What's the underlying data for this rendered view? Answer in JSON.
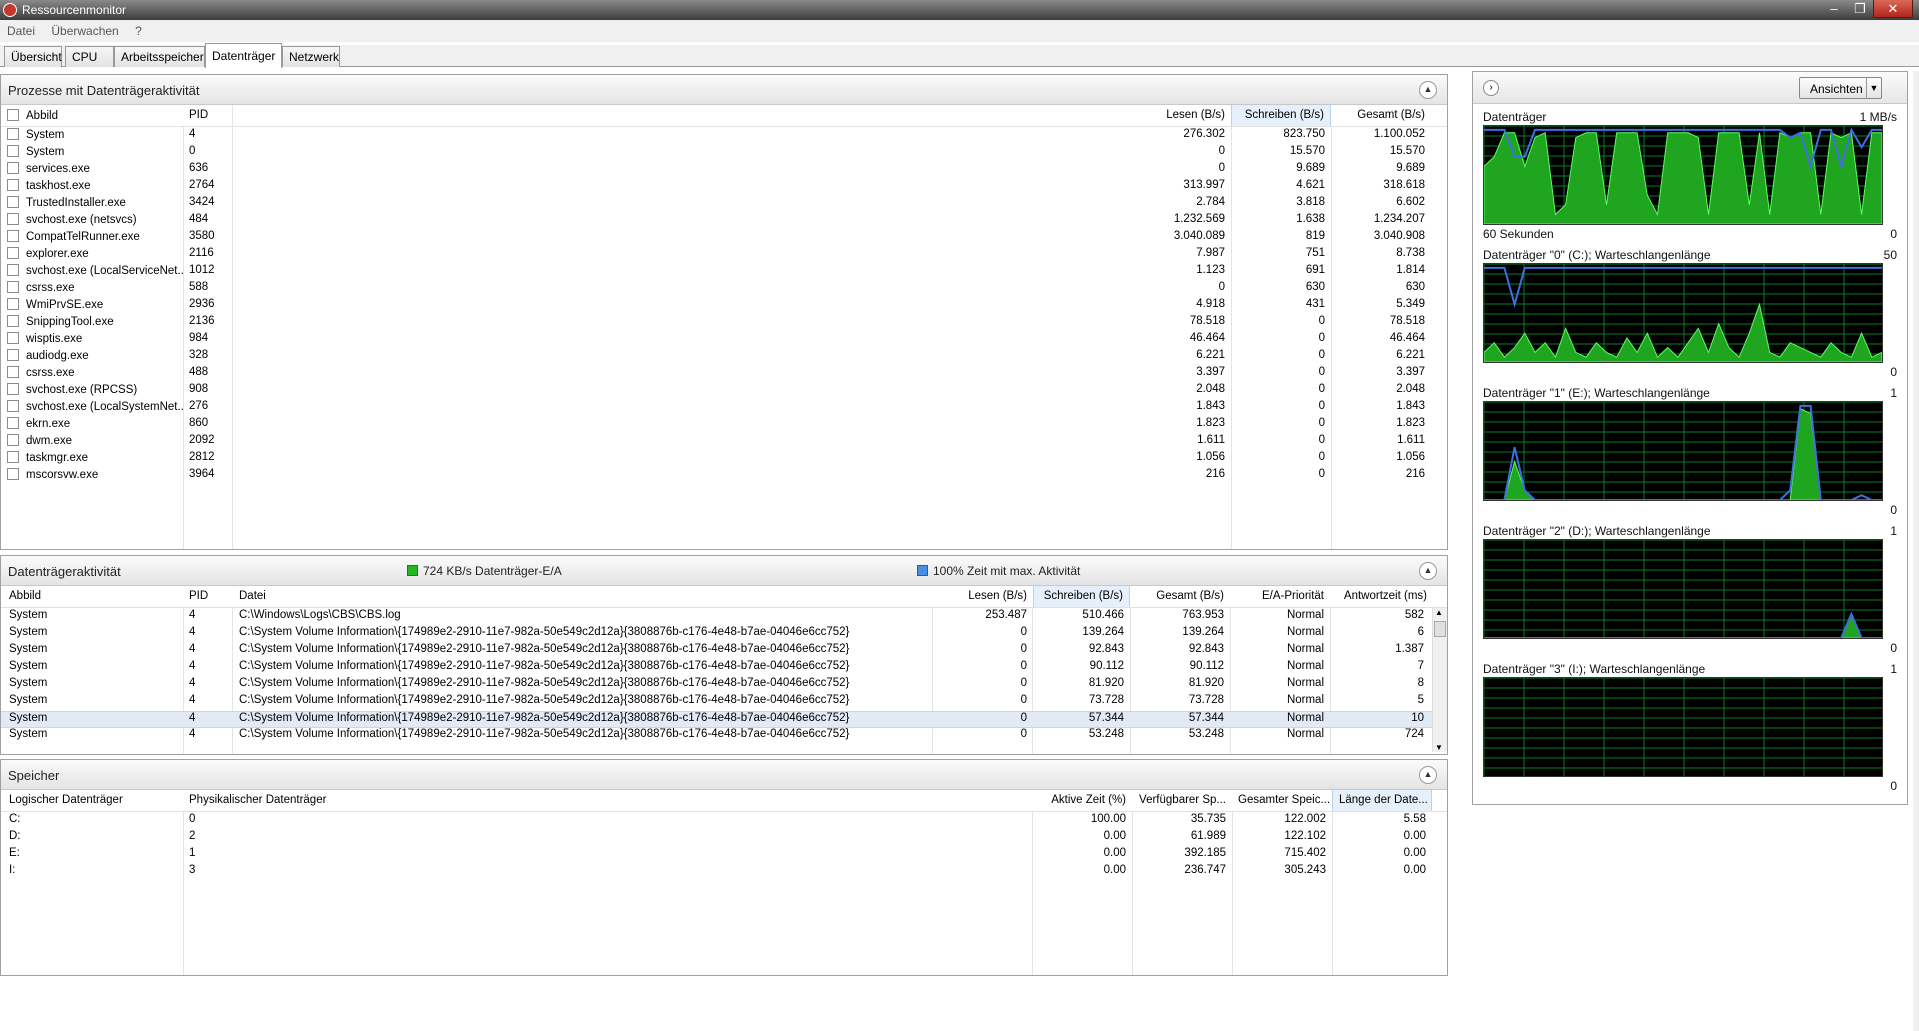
{
  "window": {
    "title": "Ressourcenmonitor"
  },
  "menu": [
    "Datei",
    "Überwachen",
    "?"
  ],
  "tabs": [
    "Übersicht",
    "CPU",
    "Arbeitsspeicher",
    "Datenträger",
    "Netzwerk"
  ],
  "processes": {
    "title": "Prozesse mit Datenträgeraktivität",
    "headers": {
      "name": "Abbild",
      "pid": "PID",
      "read": "Lesen (B/s)",
      "write": "Schreiben (B/s)",
      "total": "Gesamt (B/s)"
    },
    "rows": [
      [
        "System",
        "4",
        "276.302",
        "823.750",
        "1.100.052"
      ],
      [
        "System",
        "0",
        "0",
        "15.570",
        "15.570"
      ],
      [
        "services.exe",
        "636",
        "0",
        "9.689",
        "9.689"
      ],
      [
        "taskhost.exe",
        "2764",
        "313.997",
        "4.621",
        "318.618"
      ],
      [
        "TrustedInstaller.exe",
        "3424",
        "2.784",
        "3.818",
        "6.602"
      ],
      [
        "svchost.exe (netsvcs)",
        "484",
        "1.232.569",
        "1.638",
        "1.234.207"
      ],
      [
        "CompatTelRunner.exe",
        "3580",
        "3.040.089",
        "819",
        "3.040.908"
      ],
      [
        "explorer.exe",
        "2116",
        "7.987",
        "751",
        "8.738"
      ],
      [
        "svchost.exe (LocalServiceNet...",
        "1012",
        "1.123",
        "691",
        "1.814"
      ],
      [
        "csrss.exe",
        "588",
        "0",
        "630",
        "630"
      ],
      [
        "WmiPrvSE.exe",
        "2936",
        "4.918",
        "431",
        "5.349"
      ],
      [
        "SnippingTool.exe",
        "2136",
        "78.518",
        "0",
        "78.518"
      ],
      [
        "wisptis.exe",
        "984",
        "46.464",
        "0",
        "46.464"
      ],
      [
        "audiodg.exe",
        "328",
        "6.221",
        "0",
        "6.221"
      ],
      [
        "csrss.exe",
        "488",
        "3.397",
        "0",
        "3.397"
      ],
      [
        "svchost.exe (RPCSS)",
        "908",
        "2.048",
        "0",
        "2.048"
      ],
      [
        "svchost.exe (LocalSystemNet...",
        "276",
        "1.843",
        "0",
        "1.843"
      ],
      [
        "ekrn.exe",
        "860",
        "1.823",
        "0",
        "1.823"
      ],
      [
        "dwm.exe",
        "2092",
        "1.611",
        "0",
        "1.611"
      ],
      [
        "taskmgr.exe",
        "2812",
        "1.056",
        "0",
        "1.056"
      ],
      [
        "mscorsvw.exe",
        "3964",
        "216",
        "0",
        "216"
      ]
    ]
  },
  "activity": {
    "title": "Datenträgeraktivität",
    "legend_io": "724 KB/s Datenträger-E/A",
    "legend_active": "100% Zeit mit max. Aktivität",
    "colors": {
      "io": "#22b822",
      "active": "#4a90e2"
    },
    "headers": {
      "name": "Abbild",
      "pid": "PID",
      "file": "Datei",
      "read": "Lesen (B/s)",
      "write": "Schreiben (B/s)",
      "total": "Gesamt (B/s)",
      "prio": "E/A-Priorität",
      "resp": "Antwortzeit (ms)"
    },
    "rows": [
      [
        "System",
        "4",
        "C:\\Windows\\Logs\\CBS\\CBS.log",
        "253.487",
        "510.466",
        "763.953",
        "Normal",
        "582"
      ],
      [
        "System",
        "4",
        "C:\\System Volume Information\\{174989e2-2910-11e7-982a-50e549c2d12a}{3808876b-c176-4e48-b7ae-04046e6cc752}",
        "0",
        "139.264",
        "139.264",
        "Normal",
        "6"
      ],
      [
        "System",
        "4",
        "C:\\System Volume Information\\{174989e2-2910-11e7-982a-50e549c2d12a}{3808876b-c176-4e48-b7ae-04046e6cc752}",
        "0",
        "92.843",
        "92.843",
        "Normal",
        "1.387"
      ],
      [
        "System",
        "4",
        "C:\\System Volume Information\\{174989e2-2910-11e7-982a-50e549c2d12a}{3808876b-c176-4e48-b7ae-04046e6cc752}",
        "0",
        "90.112",
        "90.112",
        "Normal",
        "7"
      ],
      [
        "System",
        "4",
        "C:\\System Volume Information\\{174989e2-2910-11e7-982a-50e549c2d12a}{3808876b-c176-4e48-b7ae-04046e6cc752}",
        "0",
        "81.920",
        "81.920",
        "Normal",
        "8"
      ],
      [
        "System",
        "4",
        "C:\\System Volume Information\\{174989e2-2910-11e7-982a-50e549c2d12a}{3808876b-c176-4e48-b7ae-04046e6cc752}",
        "0",
        "73.728",
        "73.728",
        "Normal",
        "5"
      ],
      [
        "System",
        "4",
        "C:\\System Volume Information\\{174989e2-2910-11e7-982a-50e549c2d12a}{3808876b-c176-4e48-b7ae-04046e6cc752}",
        "0",
        "57.344",
        "57.344",
        "Normal",
        "10"
      ],
      [
        "System",
        "4",
        "C:\\System Volume Information\\{174989e2-2910-11e7-982a-50e549c2d12a}{3808876b-c176-4e48-b7ae-04046e6cc752}",
        "0",
        "53.248",
        "53.248",
        "Normal",
        "724"
      ]
    ],
    "selected_row": 6
  },
  "storage": {
    "title": "Speicher",
    "headers": {
      "logical": "Logischer Datenträger",
      "physical": "Physikalischer Datenträger",
      "active": "Aktive Zeit (%)",
      "avail": "Verfügbarer Sp...",
      "total": "Gesamter Speic...",
      "queue": "Länge der Date..."
    },
    "rows": [
      [
        "C:",
        "0",
        "100.00",
        "35.735",
        "122.002",
        "5.58"
      ],
      [
        "D:",
        "2",
        "0.00",
        "61.989",
        "122.102",
        "0.00"
      ],
      [
        "E:",
        "1",
        "0.00",
        "392.185",
        "715.402",
        "0.00"
      ],
      [
        "I:",
        "3",
        "0.00",
        "236.747",
        "305.243",
        "0.00"
      ]
    ]
  },
  "sidebar": {
    "views_label": "Ansichten",
    "graphs": [
      {
        "title": "Datenträger",
        "max": "1 MB/s",
        "footer_left": "60 Sekunden",
        "min": "0"
      },
      {
        "title": "Datenträger \"0\" (C:); Warteschlangenlänge",
        "max": "50",
        "min": "0"
      },
      {
        "title": "Datenträger \"1\" (E:); Warteschlangenlänge",
        "max": "1",
        "min": "0"
      },
      {
        "title": "Datenträger \"2\" (D:); Warteschlangenlänge",
        "max": "1",
        "min": "0"
      },
      {
        "title": "Datenträger \"3\" (I:); Warteschlangenlänge",
        "max": "1",
        "min": "0"
      }
    ]
  }
}
